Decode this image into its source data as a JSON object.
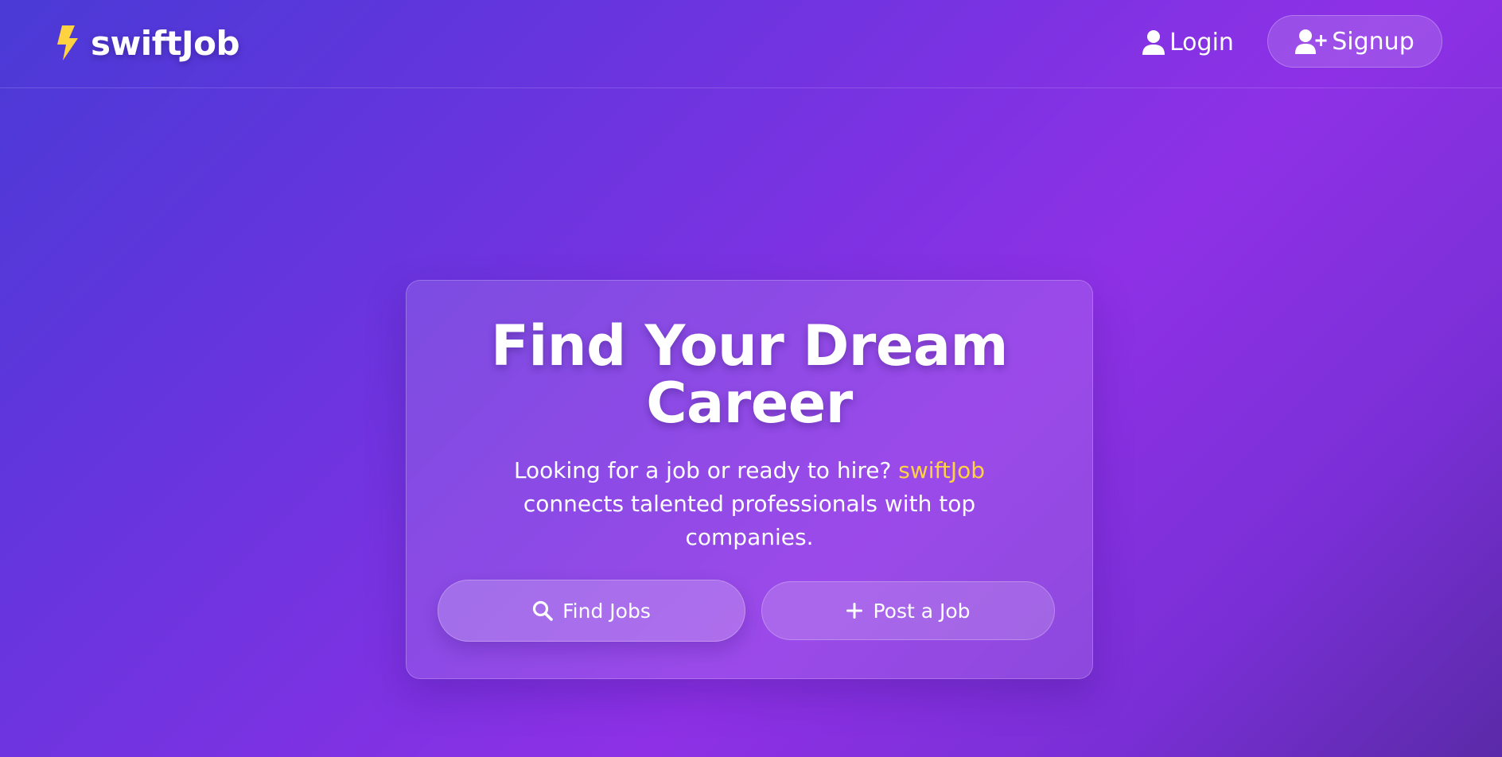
{
  "header": {
    "brand": {
      "name": "swiftJob",
      "icon": "lightning-bolt-icon",
      "icon_color": "#ffd23f"
    },
    "nav": {
      "login_label": "Login",
      "login_icon": "user-icon",
      "signup_label": "Signup",
      "signup_icon": "user-plus-icon"
    }
  },
  "hero": {
    "title": "Find Your Dream Career",
    "description_before": "Looking for a job or ready to hire? ",
    "description_highlight": "swiftJob",
    "description_after": " connects talented professionals with top companies.",
    "highlight_color": "#ffd23f",
    "buttons": {
      "find_jobs_label": "Find Jobs",
      "find_jobs_icon": "search-icon",
      "post_job_label": "Post a Job",
      "post_job_icon": "plus-icon"
    }
  },
  "theme": {
    "gradient_colors": [
      "#4a3ad6",
      "#8e31e6",
      "#5a2aa8"
    ],
    "text_color": "#ffffff"
  }
}
